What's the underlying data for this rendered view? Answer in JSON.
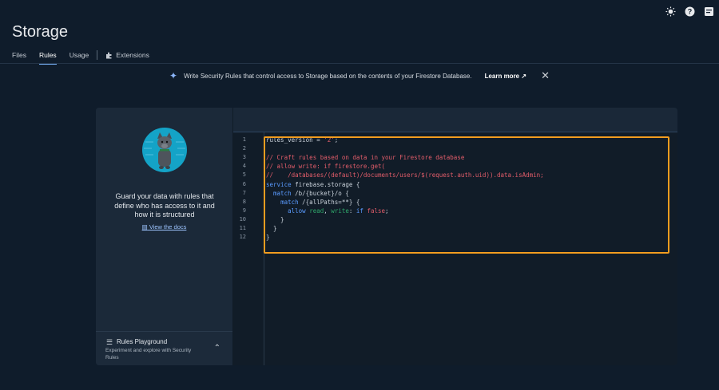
{
  "header": {
    "title": "Storage",
    "tabs": [
      {
        "label": "Files"
      },
      {
        "label": "Rules"
      },
      {
        "label": "Usage"
      },
      {
        "label": "Extensions"
      }
    ]
  },
  "banner": {
    "text": "Write Security Rules that control access to Storage based on the contents of your Firestore Database.",
    "learn_more": "Learn more"
  },
  "left_panel": {
    "guard_text": "Guard your data with rules that define who has access to it and how it is structured",
    "docs_link": "View the docs",
    "playground_title": "Rules Playground",
    "playground_desc": "Experiment and explore with Security Rules"
  },
  "editor": {
    "line_numbers": [
      "1",
      "2",
      "3",
      "4",
      "5",
      "6",
      "7",
      "8",
      "9",
      "10",
      "11",
      "12"
    ],
    "lines": [
      "rules_version = '2';",
      "",
      "// Craft rules based on data in your Firestore database",
      "// allow write: if firestore.get(",
      "//    /databases/(default)/documents/users/$(request.auth.uid)).data.isAdmin;",
      "service firebase.storage {",
      "  match /b/{bucket}/o {",
      "    match /{allPaths=**} {",
      "      allow read, write: if false;",
      "    }",
      "  }",
      "}"
    ]
  },
  "colors": {
    "accent": "#7ab7ff",
    "highlight": "#f29c1f",
    "comment": "#e35d6a",
    "keyword": "#5a9bff"
  }
}
